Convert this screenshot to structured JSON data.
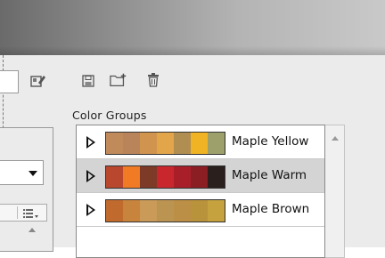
{
  "panel": {
    "section_title": "Color Groups"
  },
  "toolbar": {
    "icons": [
      "edit-swatch-icon",
      "save-icon",
      "new-group-icon",
      "delete-icon"
    ]
  },
  "color_groups": [
    {
      "label": "Maple Yellow",
      "selected": false,
      "swatches": [
        "#c08a5a",
        "#b9845a",
        "#d1944f",
        "#e3a54a",
        "#b08e52",
        "#efb323",
        "#9ea06b"
      ]
    },
    {
      "label": "Maple Warm",
      "selected": true,
      "swatches": [
        "#b8472e",
        "#f07b24",
        "#7d3a26",
        "#c9272e",
        "#a81f2a",
        "#8a1e22",
        "#2b1f1d"
      ]
    },
    {
      "label": "Maple Brown",
      "selected": false,
      "swatches": [
        "#c06a2e",
        "#c8843d",
        "#c99a58",
        "#bc9452",
        "#bc8f46",
        "#b9923c",
        "#c5a23e"
      ]
    }
  ]
}
